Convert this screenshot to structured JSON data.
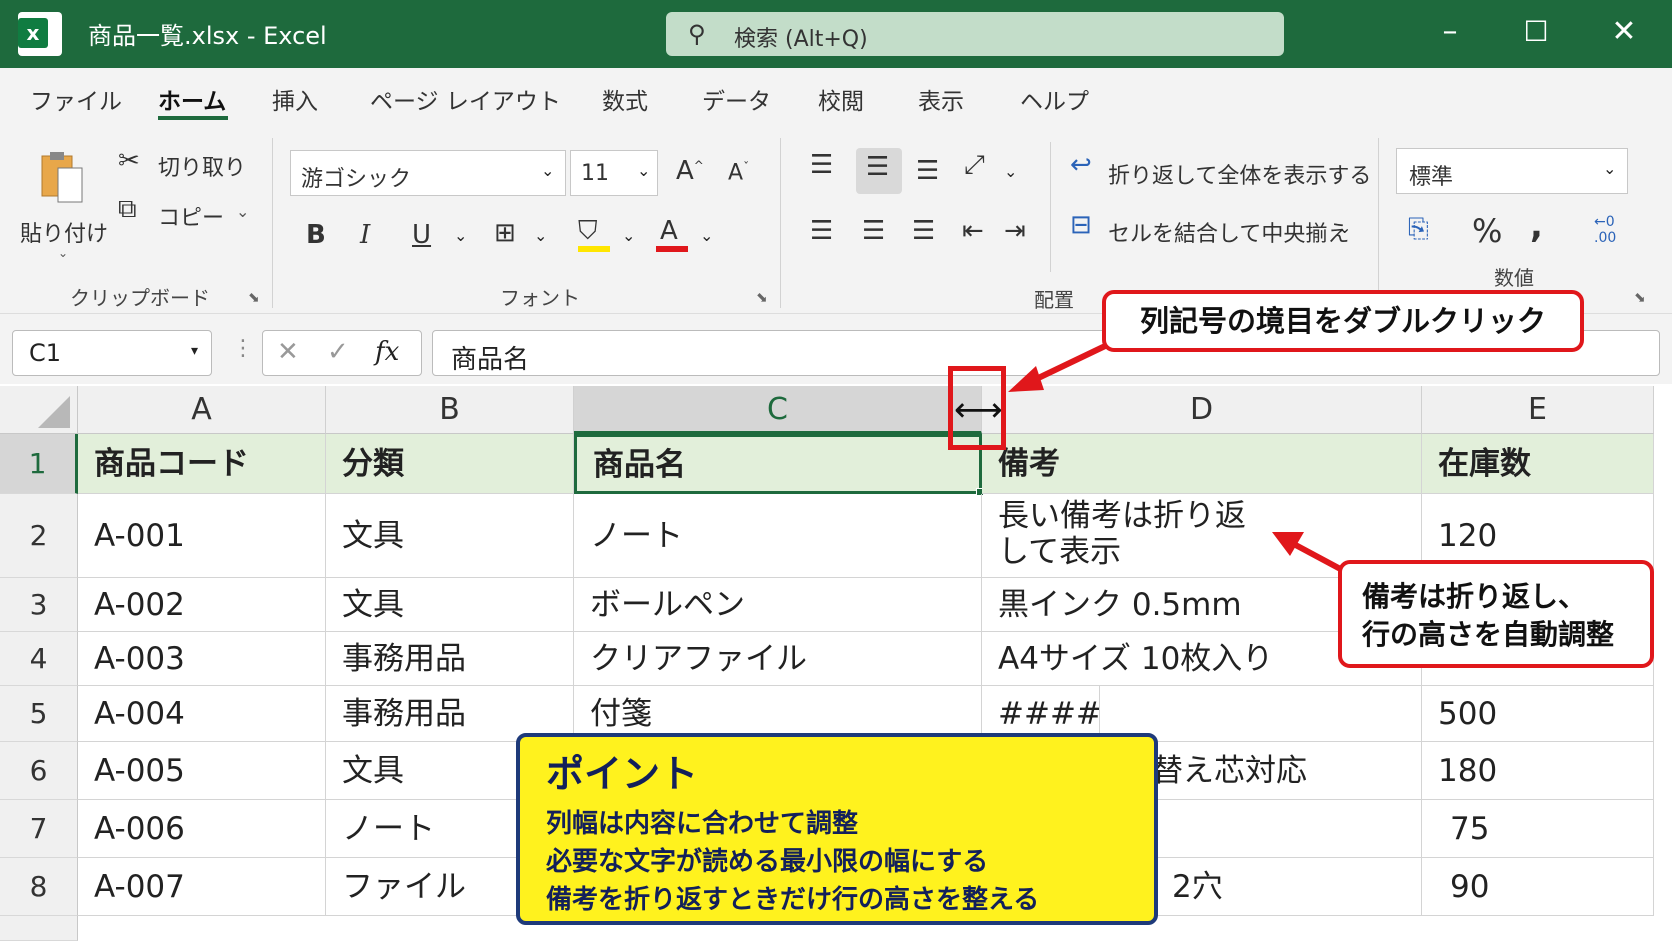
{
  "window": {
    "title": "商品一覧.xlsx  -  Excel",
    "search_label": "検索 (Alt+Q)"
  },
  "tabs": [
    "ファイル",
    "ホーム",
    "挿入",
    "ページ レイアウト",
    "数式",
    "データ",
    "校閲",
    "表示",
    "ヘルプ"
  ],
  "ribbon": {
    "paste": "貼り付け",
    "cut": "切り取り",
    "copy": "コピー",
    "clipboard_group": "クリップボード",
    "font_name": "游ゴシック",
    "font_size": "11",
    "bold": "B",
    "italic": "I",
    "underline": "U",
    "font_group": "フォント",
    "wrap_text": "折り返して全体を表示する",
    "merge_center": "セルを結合して中央揃え",
    "alignment_group": "配置",
    "number_format": "標準",
    "number_group": "数値",
    "percent": "%",
    "comma": ","
  },
  "formula_bar": {
    "name_box": "C1",
    "fx": "fx",
    "value": "商品名"
  },
  "sheet": {
    "columns": [
      "A",
      "B",
      "C",
      "D",
      "E"
    ],
    "rows": [
      "1",
      "2",
      "3",
      "4",
      "5",
      "6",
      "7",
      "8"
    ],
    "cells": [
      [
        "商品コード",
        "分類",
        "商品名",
        "備考",
        "在庫数"
      ],
      [
        "A-001",
        "文具",
        "ノート",
        "長い備考は折り返して表示",
        "120"
      ],
      [
        "A-002",
        "文具",
        "ボールペン",
        "黒インク 0.5mm",
        ""
      ],
      [
        "A-003",
        "事務用品",
        "クリアファイル",
        "A4サイズ 10枚入り",
        ""
      ],
      [
        "A-004",
        "事務用品",
        "付箋",
        "####",
        "500"
      ],
      [
        "A-005",
        "文具",
        "",
        "替え芯対応",
        "180"
      ],
      [
        "A-006",
        "ノート",
        "",
        "",
        "75"
      ],
      [
        "A-007",
        "ファイル",
        "",
        "2穴",
        "90"
      ]
    ],
    "d2_line1": "長い備考は折り返",
    "d2_line2": "して表示"
  },
  "annotations": {
    "double_click": "列記号の境目をダブルクリック",
    "wrap_note_line1": "備考は折り返し、",
    "wrap_note_line2": "行の高さを自動調整",
    "point_title": "ポイント",
    "point_lines": [
      "列幅は内容に合わせて調整",
      "必要な文字が読める最小限の幅にする",
      "備考を折り返すときだけ行の高さを整える"
    ]
  },
  "colors": {
    "excel_green": "#1e6a3d",
    "callout_red": "#e0171b",
    "point_yellow": "#fff21e",
    "point_border": "#1e3a7a"
  }
}
